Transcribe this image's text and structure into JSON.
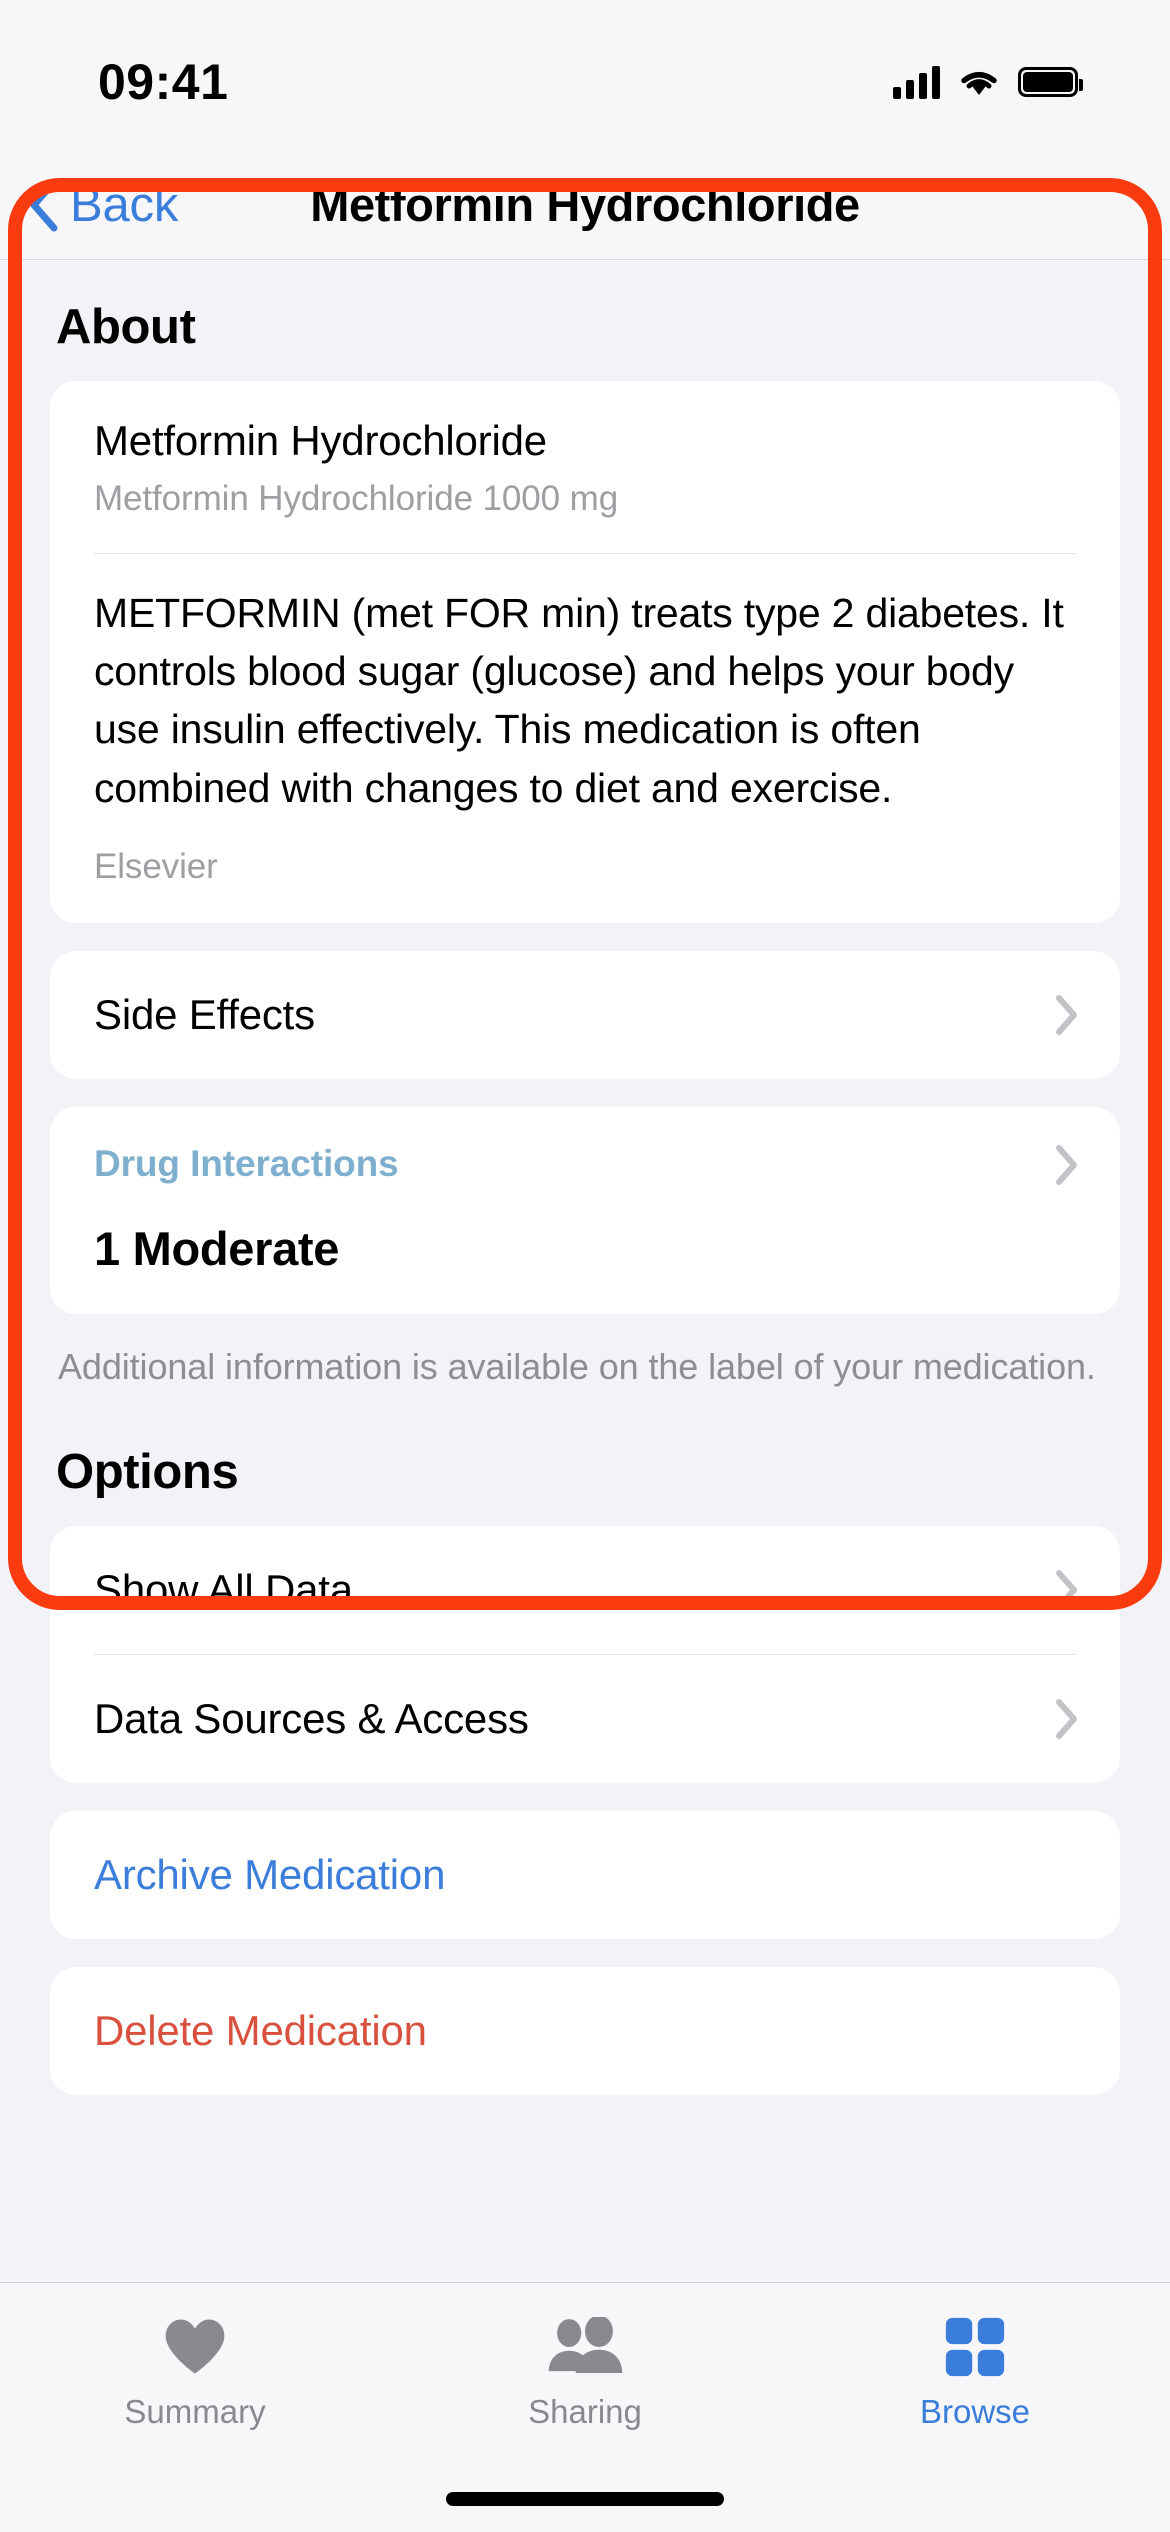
{
  "status_bar": {
    "time": "09:41",
    "cellular_icon": "signal-bars-icon",
    "wifi_icon": "wifi-icon",
    "battery_icon": "battery-icon"
  },
  "nav": {
    "back_label": "Back",
    "back_icon": "chevron-left-icon",
    "title": "Metformin Hydrochloride"
  },
  "about": {
    "header": "About",
    "medication": {
      "name": "Metformin Hydrochloride",
      "strength": "Metformin Hydrochloride 1000 mg",
      "description": "METFORMIN (met FOR min) treats type 2 diabetes. It controls blood sugar (glucose) and helps your body use insulin effectively. This medication is often combined with changes to diet and exercise.",
      "source": "Elsevier"
    },
    "side_effects": {
      "label": "Side Effects",
      "chevron_icon": "chevron-right-icon"
    },
    "drug_interactions": {
      "link_label": "Drug Interactions",
      "count_label": "1 Moderate",
      "chevron_icon": "chevron-right-icon",
      "link_color": "#7FAFCF"
    },
    "footnote": "Additional information is available on the label of your medication."
  },
  "options": {
    "header": "Options",
    "rows": [
      {
        "label": "Show All Data",
        "style": "default",
        "chevron_icon": "chevron-right-icon"
      },
      {
        "label": "Data Sources & Access",
        "style": "default",
        "chevron_icon": "chevron-right-icon"
      }
    ],
    "archive": {
      "label": "Archive Medication",
      "color": "#3A7DDB"
    },
    "delete": {
      "label": "Delete Medication",
      "color": "#D9513E"
    }
  },
  "tab_bar": {
    "tabs": [
      {
        "label": "Summary",
        "icon": "heart-icon",
        "active": false
      },
      {
        "label": "Sharing",
        "icon": "people-icon",
        "active": false
      },
      {
        "label": "Browse",
        "icon": "grid-squares-icon",
        "active": true
      }
    ],
    "active_color": "#3A7DDB",
    "inactive_color": "#8A8A8E"
  },
  "annotation": {
    "shape": "rounded-rectangle-highlight",
    "color": "#FA3B10"
  }
}
